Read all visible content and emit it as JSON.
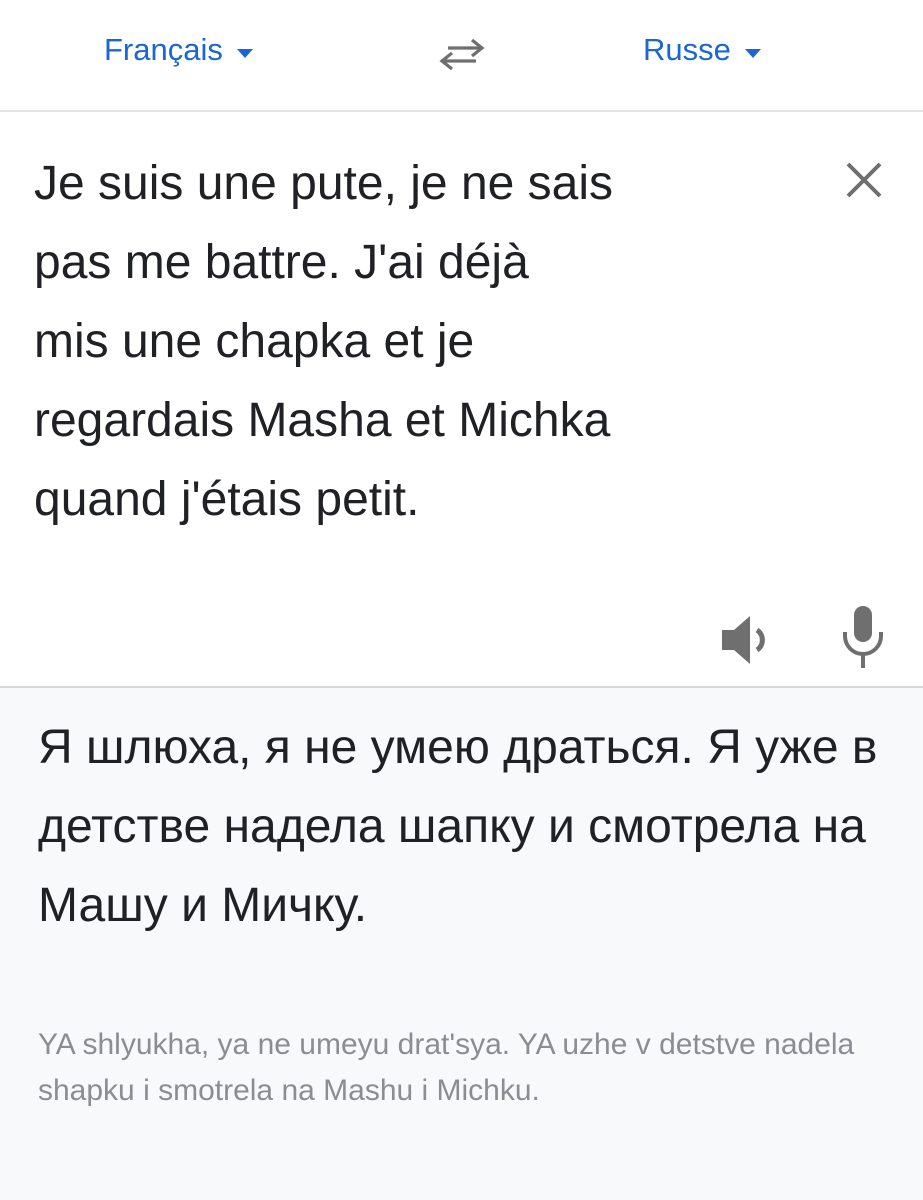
{
  "header": {
    "source_language": "Français",
    "target_language": "Russe"
  },
  "input": {
    "text": "Je suis une pute, je ne sais\npas me battre. J'ai déjà\nmis une chapka et je\nregardais Masha et Michka\nquand j'étais petit."
  },
  "output": {
    "translation": "Я шлюха, я не умею драться. Я уже в детстве надела шапку и смотрела на Машу и Мичку.",
    "romanization": "YA shlyukha, ya ne umeyu drat'sya. YA uzhe v detstve nadela shapku i smotrela na Mashu i Michku."
  },
  "icons": {
    "caret": "caret-down-icon",
    "swap": "swap-languages-icon",
    "clear": "close-icon",
    "speaker": "speaker-icon",
    "mic": "microphone-icon"
  },
  "colors": {
    "accent": "#1a66d2",
    "icon": "#6f6f6f",
    "output_bg": "#f8f9fa"
  }
}
